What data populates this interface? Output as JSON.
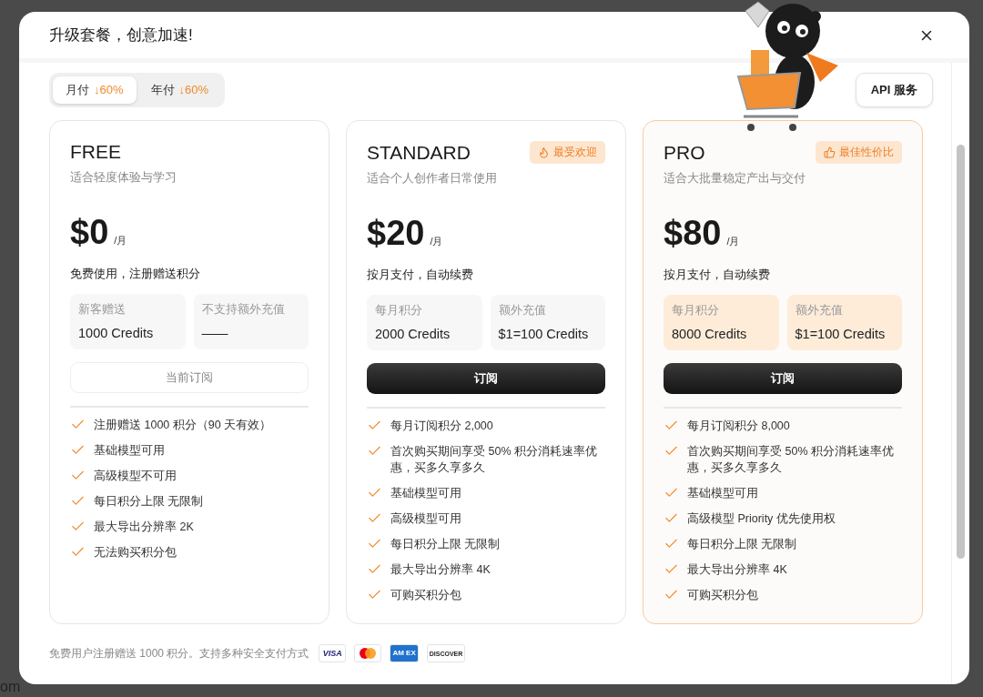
{
  "background": {
    "fragment": "om"
  },
  "dialog": {
    "title": "升级套餐，创意加速!"
  },
  "billing_tabs": [
    {
      "label": "月付",
      "discount": "↓60%",
      "selected": true
    },
    {
      "label": "年付",
      "discount": "↓60%",
      "selected": false
    }
  ],
  "api_button": "API 服务",
  "plans": [
    {
      "name": "FREE",
      "subtitle": "适合轻度体验与学习",
      "price": "$0",
      "period": "/月",
      "note": "免费使用，注册赠送积分",
      "highlighted": false,
      "stats": [
        {
          "label": "新客赠送",
          "value": "1000 Credits"
        },
        {
          "label": "不支持额外充值",
          "value": "——"
        }
      ],
      "button": {
        "label": "当前订阅",
        "kind": "current"
      },
      "features": [
        "注册赠送 1000 积分（90 天有效）",
        "基础模型可用",
        "高级模型不可用",
        "每日积分上限 无限制",
        "最大导出分辨率 2K",
        "无法购买积分包"
      ]
    },
    {
      "name": "STANDARD",
      "subtitle": "适合个人创作者日常使用",
      "price": "$20",
      "period": "/月",
      "note": "按月支付，自动续费",
      "highlighted": false,
      "badge": {
        "label": "最受欢迎",
        "kind": "fire"
      },
      "stats": [
        {
          "label": "每月积分",
          "value": "2000 Credits"
        },
        {
          "label": "额外充值",
          "value": "$1=100 Credits"
        }
      ],
      "button": {
        "label": "订阅",
        "kind": "subscribe"
      },
      "features": [
        "每月订阅积分 2,000",
        "首次购买期间享受 50% 积分消耗速率优惠，买多久享多久",
        "基础模型可用",
        "高级模型可用",
        "每日积分上限 无限制",
        "最大导出分辨率 4K",
        "可购买积分包"
      ]
    },
    {
      "name": "PRO",
      "subtitle": "适合大批量稳定产出与交付",
      "price": "$80",
      "period": "/月",
      "note": "按月支付，自动续费",
      "highlighted": true,
      "badge": {
        "label": "最佳性价比",
        "kind": "thumb"
      },
      "stats": [
        {
          "label": "每月积分",
          "value": "8000 Credits"
        },
        {
          "label": "额外充值",
          "value": "$1=100 Credits"
        }
      ],
      "button": {
        "label": "订阅",
        "kind": "subscribe"
      },
      "features": [
        "每月订阅积分 8,000",
        "首次购买期间享受 50% 积分消耗速率优惠，买多久享多久",
        "基础模型可用",
        "高级模型 Priority 优先使用权",
        "每日积分上限 无限制",
        "最大导出分辨率 4K",
        "可购买积分包"
      ]
    }
  ],
  "footer": {
    "text": "免费用户注册赠送 1000 积分。支持多种安全支付方式",
    "payment_methods": [
      {
        "kind": "visa",
        "label": "VISA"
      },
      {
        "kind": "mastercard"
      },
      {
        "kind": "amex",
        "label": "AM EX"
      },
      {
        "kind": "discover",
        "label": "DISCOVER"
      }
    ]
  }
}
